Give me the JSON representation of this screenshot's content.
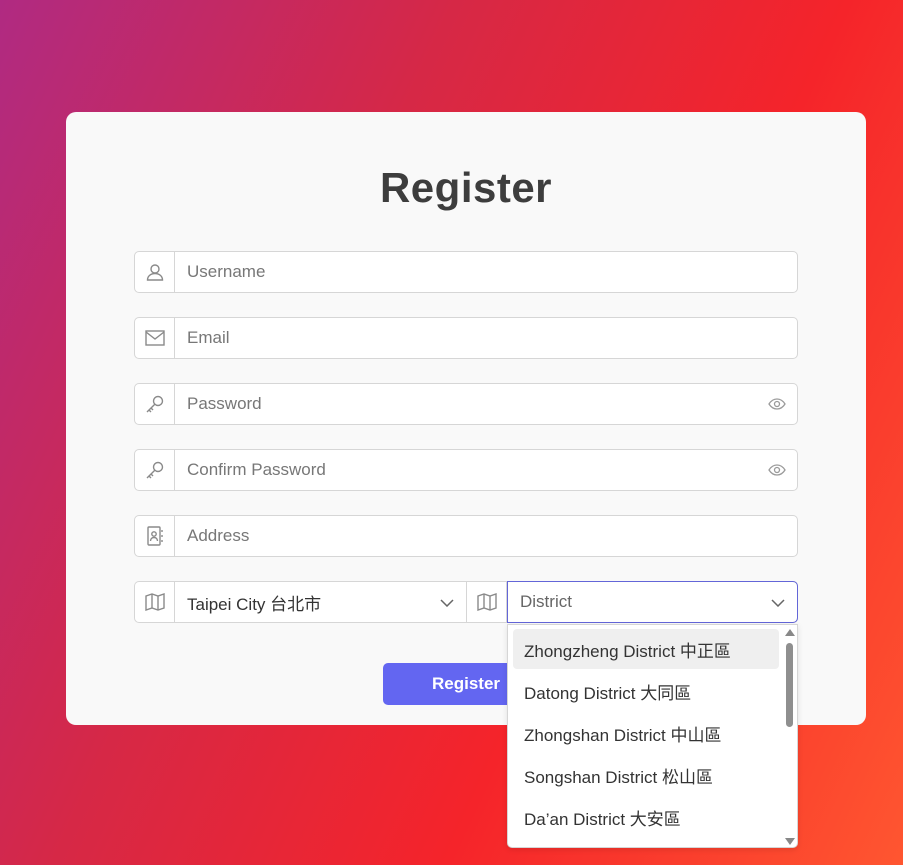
{
  "form": {
    "title": "Register",
    "username": {
      "placeholder": "Username",
      "icon": "user-icon"
    },
    "email": {
      "placeholder": "Email",
      "icon": "envelope-icon"
    },
    "password": {
      "placeholder": "Password",
      "icon": "key-icon"
    },
    "confirm_password": {
      "placeholder": "Confirm Password",
      "icon": "key-icon"
    },
    "address": {
      "placeholder": "Address",
      "icon": "address-book-icon"
    },
    "city": {
      "value": "Taipei City 台北市",
      "icon": "map-icon"
    },
    "district": {
      "value": "District",
      "icon": "map-icon"
    },
    "submit_label": "Register"
  },
  "district_dropdown": {
    "highlighted_index": 0,
    "options": [
      "Zhongzheng District 中正區",
      "Datong District 大同區",
      "Zhongshan District 中山區",
      "Songshan District 松山區",
      "Da’an District 大安區"
    ]
  },
  "colors": {
    "accent": "#6366f1",
    "focus_border": "#6366d8",
    "card": "#f9f9f9"
  }
}
